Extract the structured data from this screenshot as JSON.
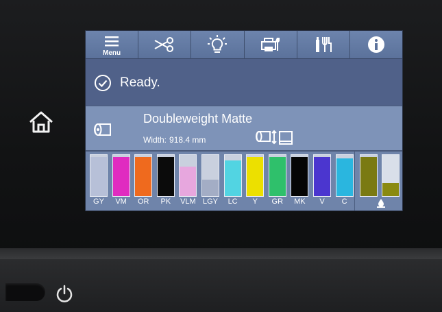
{
  "toolbar": {
    "menu_label": "Menu",
    "tabs": [
      {
        "icon": "menu-icon"
      },
      {
        "icon": "scissors-icon"
      },
      {
        "icon": "lightbulb-icon"
      },
      {
        "icon": "printer-maintenance-icon"
      },
      {
        "icon": "ink-tools-icon"
      },
      {
        "icon": "info-icon"
      }
    ]
  },
  "status": {
    "icon": "check-circle-icon",
    "text": "Ready."
  },
  "paper": {
    "icon": "roll-paper-icon",
    "name": "Doubleweight Matte",
    "width_label": "Width:",
    "width_value": "918.4 mm",
    "feed_icon": "roll-feed-icon"
  },
  "inks": [
    {
      "label": "GY",
      "color": "#b7c0d8",
      "level": 0.98
    },
    {
      "label": "VM",
      "color": "#e02bc0",
      "level": 0.98
    },
    {
      "label": "OR",
      "color": "#ef6a1e",
      "level": 0.98
    },
    {
      "label": "PK",
      "color": "#0b0b0b",
      "level": 0.98
    },
    {
      "label": "VLM",
      "color": "#e7a7de",
      "level": 0.75
    },
    {
      "label": "LGY",
      "color": "#a3adc5",
      "level": 0.42
    },
    {
      "label": "LC",
      "color": "#52d4e2",
      "level": 0.9
    },
    {
      "label": "Y",
      "color": "#ece000",
      "level": 0.98
    },
    {
      "label": "GR",
      "color": "#2fc06b",
      "level": 0.98
    },
    {
      "label": "MK",
      "color": "#050505",
      "level": 0.98
    },
    {
      "label": "V",
      "color": "#4b36cf",
      "level": 0.98
    },
    {
      "label": "C",
      "color": "#2ab6df",
      "level": 0.95
    }
  ],
  "maintenance": {
    "color": "#7a7a12",
    "level": 0.98,
    "icon": "maintenance-tank-icon"
  },
  "maintenance2": {
    "color": "#8a8a10",
    "level": 0.32
  },
  "colors": {
    "accent": "#5b729b",
    "screen_bg": "#4a5a7a"
  }
}
